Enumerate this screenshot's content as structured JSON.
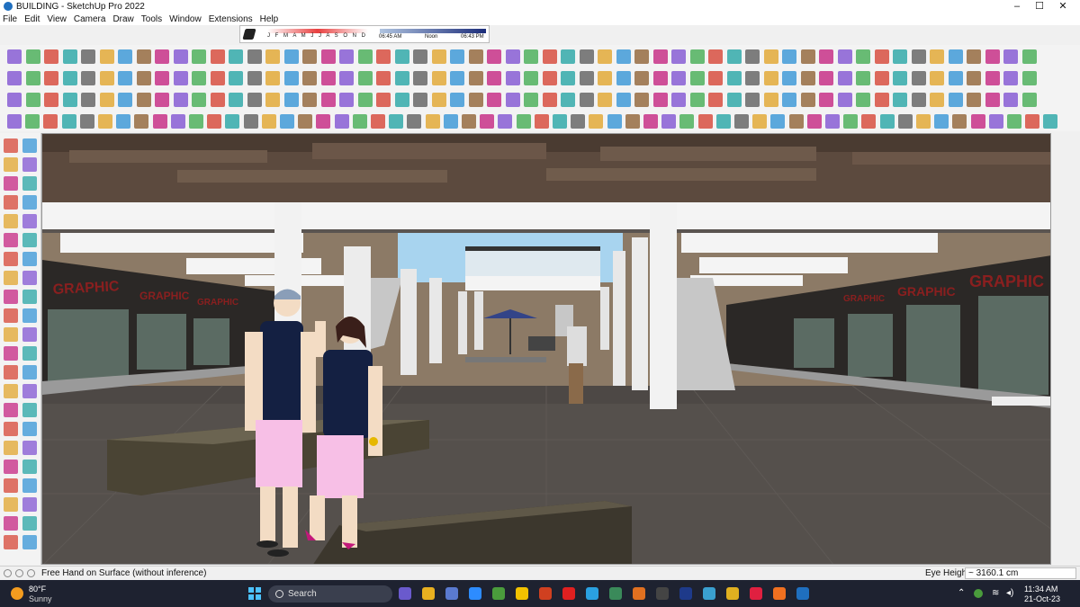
{
  "window": {
    "title": "BUILDING - SketchUp Pro 2022",
    "controls": [
      "–",
      "☐",
      "✕"
    ]
  },
  "menu": [
    "File",
    "Edit",
    "View",
    "Camera",
    "Draw",
    "Tools",
    "Window",
    "Extensions",
    "Help"
  ],
  "shadows": {
    "months": "J F M A M J J A S O N D",
    "time_start": "06:45 AM",
    "time_mid": "Noon",
    "time_end": "06:43 PM"
  },
  "scene": {
    "sign_text": "GRAPHIC"
  },
  "status": {
    "help_text": "Free Hand on Surface (without inference)",
    "vcb_label": "Eye Height",
    "vcb_value": "~ 3160.1 cm"
  },
  "taskbar": {
    "temperature": "80°F",
    "condition": "Sunny",
    "search_placeholder": "Search",
    "time": "11:34 AM",
    "date": "21-Oct-23"
  },
  "colors": {
    "accent": "#1f6fbf",
    "taskbar": "#1e2230"
  }
}
